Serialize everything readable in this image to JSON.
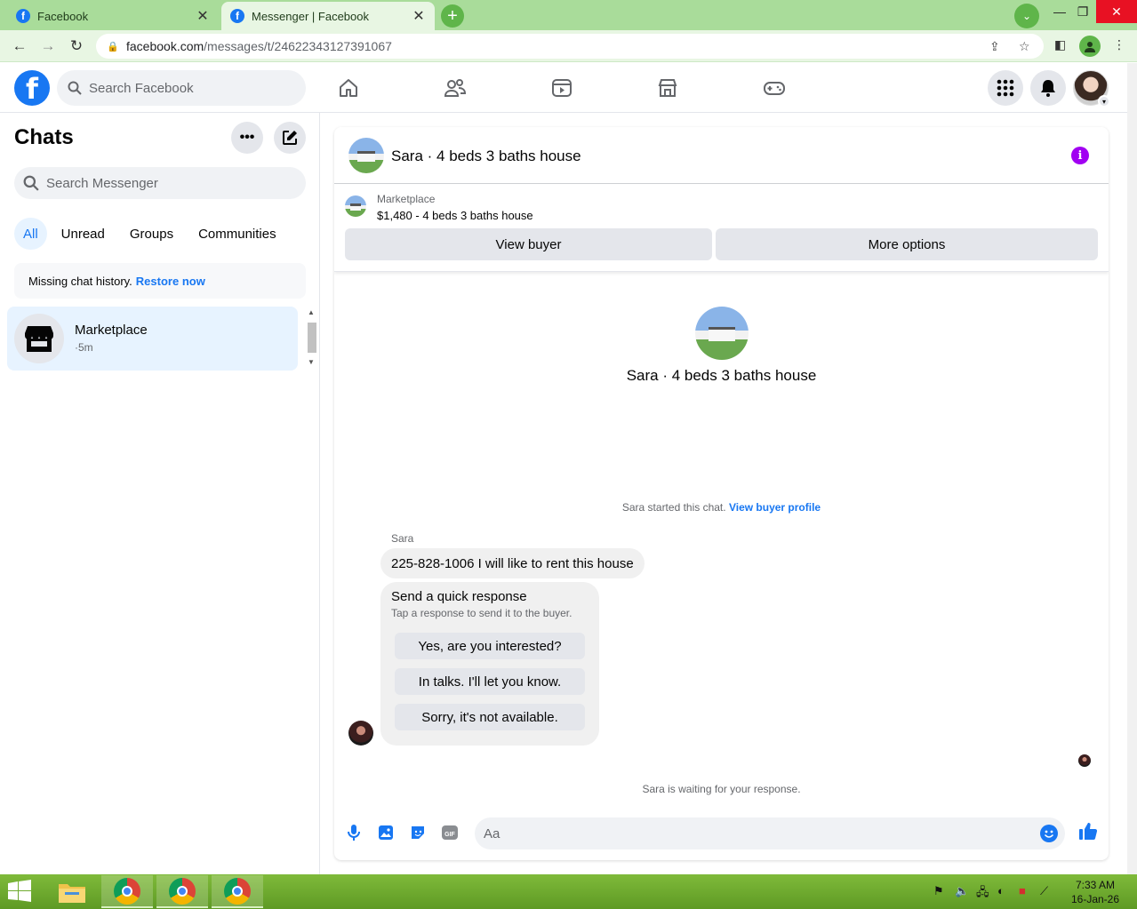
{
  "browser": {
    "tabs": [
      {
        "title": "Facebook"
      },
      {
        "title": "Messenger | Facebook"
      }
    ],
    "url_main": "facebook.com",
    "url_path": "/messages/t/24622343127391067"
  },
  "fb": {
    "search_placeholder": "Search Facebook"
  },
  "sidebar": {
    "title": "Chats",
    "search_placeholder": "Search Messenger",
    "filters": [
      "All",
      "Unread",
      "Groups",
      "Communities"
    ],
    "restore_text": "Missing chat history.",
    "restore_link": "Restore now",
    "chats": [
      {
        "name": "Marketplace",
        "time": "·5m"
      }
    ]
  },
  "chat": {
    "title": "Sara · 4 beds 3 baths house",
    "marketplace_label": "Marketplace",
    "listing": "$1,480 - 4 beds 3 baths house",
    "view_buyer": "View buyer",
    "more_options": "More options",
    "hero_name": "Sara · 4 beds 3 baths house",
    "started_text": "Sara started this chat.",
    "view_buyer_profile": "View buyer profile",
    "sender": "Sara",
    "message": "225-828-1006 I will like to rent this house",
    "quick_title": "Send a quick response",
    "quick_sub": "Tap a response to send it to the buyer.",
    "quick_replies": [
      "Yes, are you interested?",
      "In talks. I'll let you know.",
      "Sorry, it's not available."
    ],
    "waiting": "Sara is waiting for your response.",
    "composer_placeholder": "Aa"
  },
  "taskbar": {
    "time": "7:33 AM",
    "date": "16-Jan-26"
  },
  "colors": {
    "fb_blue": "#1877f2",
    "info_purple": "#a100f2",
    "chrome_frame": "#a9dc9a"
  }
}
